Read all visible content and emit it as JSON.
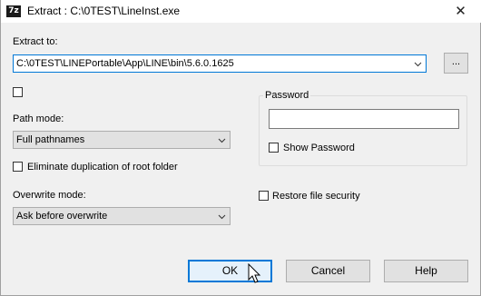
{
  "window": {
    "title": "Extract : C:\\0TEST\\LineInst.exe",
    "app_icon_text": "7z",
    "close_glyph": "✕"
  },
  "extract_to": {
    "label": "Extract to:",
    "value": "C:\\0TEST\\LINEPortable\\App\\LINE\\bin\\5.6.0.1625",
    "browse_label": "..."
  },
  "path_mode": {
    "label": "Path mode:",
    "value": "Full pathnames"
  },
  "eliminate_duplication": {
    "label": "Eliminate duplication of root folder",
    "checked": false
  },
  "overwrite_mode": {
    "label": "Overwrite mode:",
    "value": "Ask before overwrite"
  },
  "password": {
    "group_label": "Password",
    "value": "",
    "show_label": "Show Password",
    "show_checked": false
  },
  "restore_security": {
    "label": "Restore file security",
    "checked": false
  },
  "buttons": {
    "ok": "OK",
    "cancel": "Cancel",
    "help": "Help"
  },
  "colors": {
    "accent": "#0078d7",
    "background": "#f0f0f0"
  }
}
